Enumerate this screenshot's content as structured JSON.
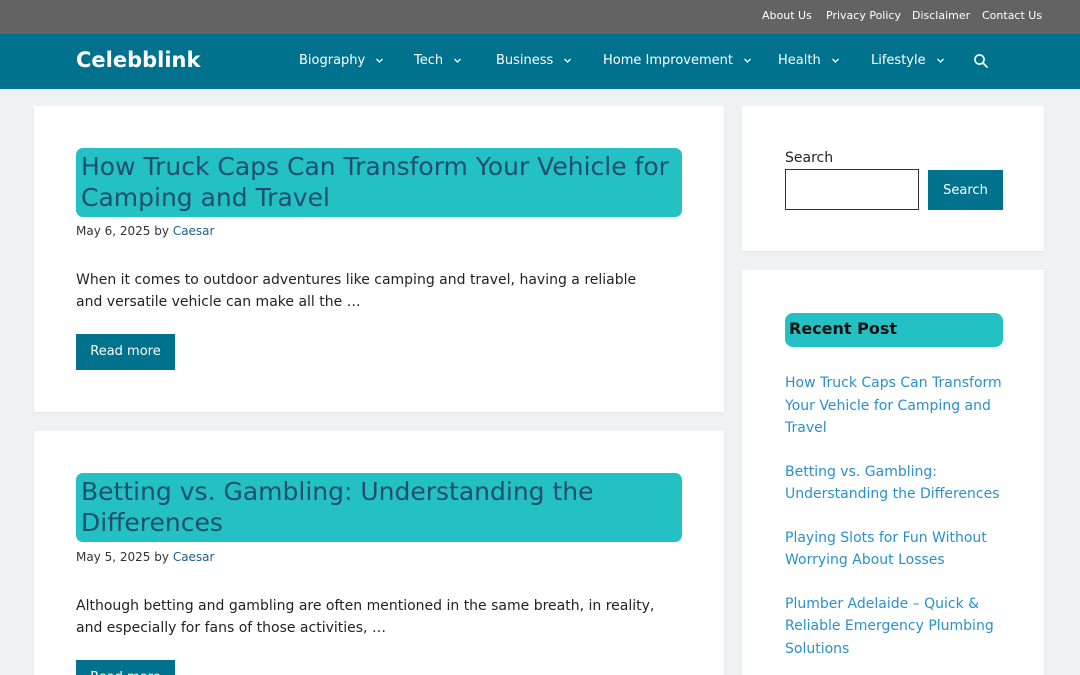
{
  "top_links": [
    "About Us",
    "Privacy Policy",
    "Disclaimer",
    "Contact Us"
  ],
  "site": {
    "title": "Celebblink"
  },
  "nav": [
    {
      "label": "Biography"
    },
    {
      "label": "Tech"
    },
    {
      "label": "Business"
    },
    {
      "label": "Home Improvement"
    },
    {
      "label": "Health"
    },
    {
      "label": "Lifestyle"
    }
  ],
  "icons": {
    "search": "search-icon",
    "chevron": "chevron-down-icon"
  },
  "posts": [
    {
      "title": "How Truck Caps Can Transform Your Vehicle for Camping and Travel",
      "date": "May 6, 2025",
      "by": "by",
      "author": "Caesar",
      "excerpt": "When it comes to outdoor adventures like camping and travel, having a reliable and versatile vehicle can make all the …",
      "read_more": "Read more"
    },
    {
      "title": "Betting vs. Gambling: Understanding the Differences",
      "date": "May 5, 2025",
      "by": "by",
      "author": "Caesar",
      "excerpt": "Although betting and gambling are often mentioned in the same breath, in reality, and especially for fans of those activities, …",
      "read_more": "Read more"
    }
  ],
  "sidebar": {
    "search_label": "Search",
    "search_value": "",
    "search_button": "Search",
    "recent_title": "Recent Post",
    "recent": [
      "How Truck Caps Can Transform Your Vehicle for Camping and Travel",
      "Betting vs. Gambling: Understanding the Differences",
      "Playing Slots for Fun Without Worrying About Losses",
      "Plumber Adelaide – Quick & Reliable Emergency Plumbing Solutions"
    ]
  },
  "colors": {
    "topbar": "#636363",
    "header": "#01728d",
    "accent": "#23c0c4",
    "link": "#2b90c9"
  }
}
